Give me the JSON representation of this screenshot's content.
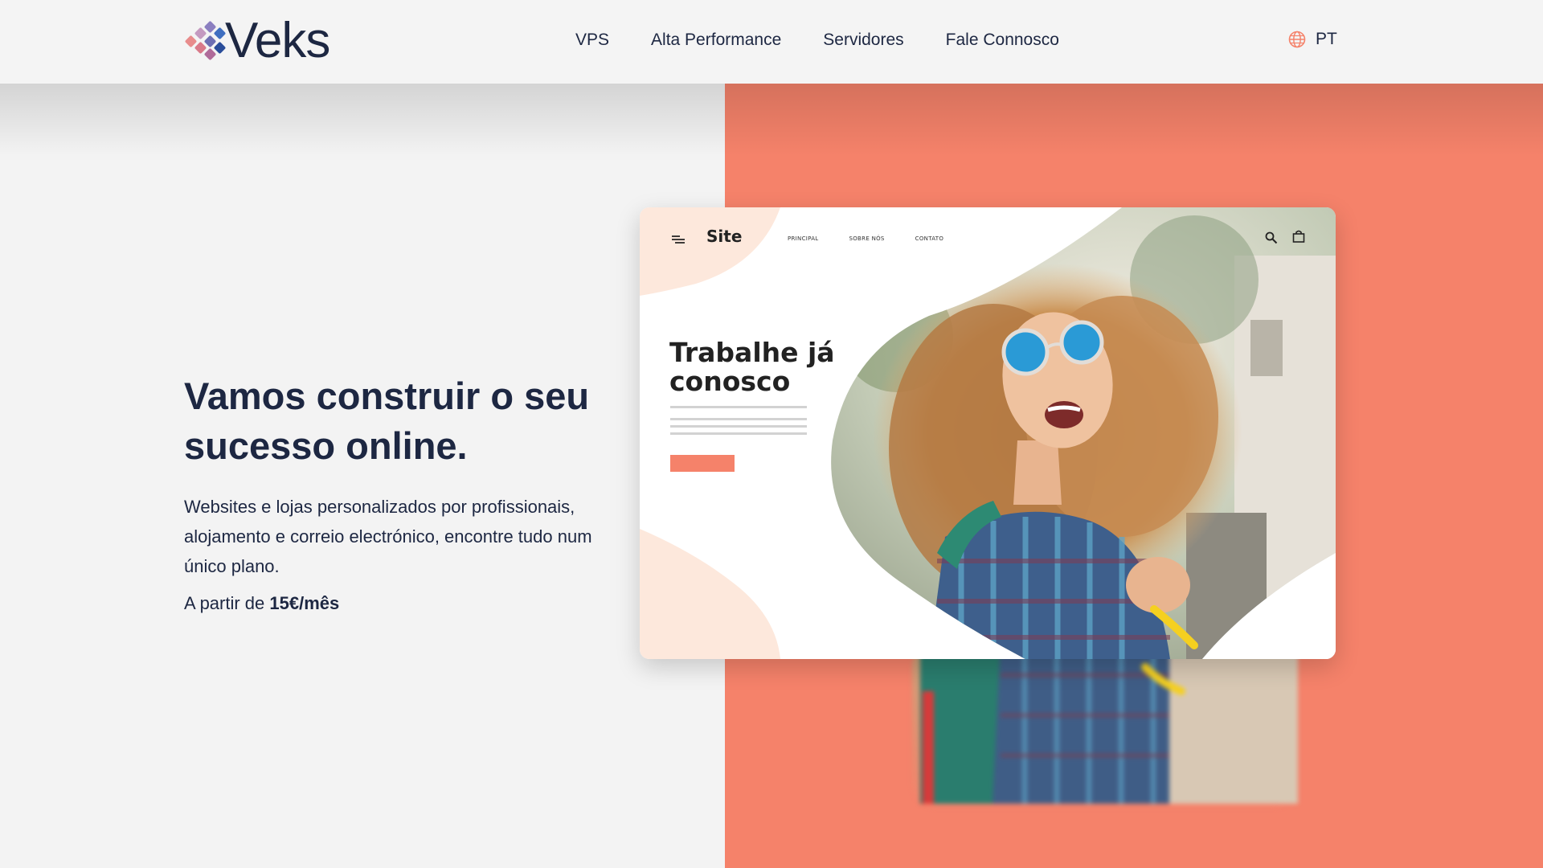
{
  "header": {
    "logo_text": "Veks",
    "nav": [
      {
        "label": "VPS"
      },
      {
        "label": "Alta Performance"
      },
      {
        "label": "Servidores"
      },
      {
        "label": "Fale Connosco"
      }
    ],
    "language": {
      "label": "PT",
      "icon": "globe-icon"
    }
  },
  "hero": {
    "title_line1": "Vamos construir o seu",
    "title_line2": "sucesso online.",
    "description": "Websites e lojas personalizados por profissionais, alojamento e correio electrónico, encontre tudo num único plano.",
    "price_prefix": "A partir de",
    "price_value": "15€/mês"
  },
  "mockup": {
    "site_name": "Site",
    "nav": [
      "PRINCIPAL",
      "SOBRE NÓS",
      "CONTATO"
    ],
    "headline_line1": "Trabalhe já",
    "headline_line2": "conosco",
    "icons": [
      "menu-icon",
      "search-icon",
      "shopping-bag-icon"
    ]
  },
  "colors": {
    "accent": "#f5826a",
    "text_dark": "#1d2742",
    "background": "#f3f3f3",
    "mockup_blob": "#fde8dc"
  }
}
